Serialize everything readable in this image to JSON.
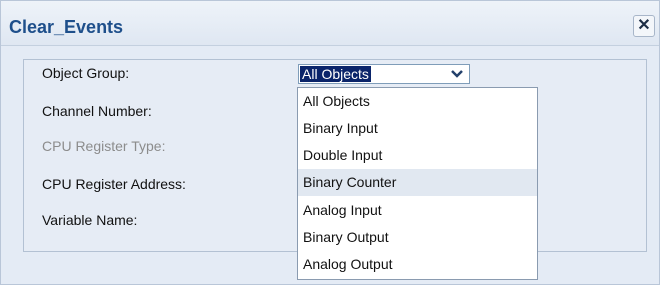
{
  "dialog": {
    "title": "Clear_Events",
    "close_icon": "close-icon"
  },
  "form": {
    "object_group_label": "Object Group:",
    "channel_number_label": "Channel Number:",
    "cpu_register_type_label": "CPU Register Type:",
    "cpu_register_address_label": "CPU Register Address:",
    "variable_name_label": "Variable Name:"
  },
  "object_group_select": {
    "value": "All Objects",
    "arrow_icon": "chevron-down-icon",
    "options": [
      "All Objects",
      "Binary Input",
      "Double Input",
      "Binary Counter",
      "Analog Input",
      "Binary Output",
      "Analog Output"
    ],
    "hovered_option": "Binary Counter"
  },
  "colors": {
    "title": "#1e4f8b",
    "selection": "#0a246a",
    "hover": "#e1e8f1"
  }
}
